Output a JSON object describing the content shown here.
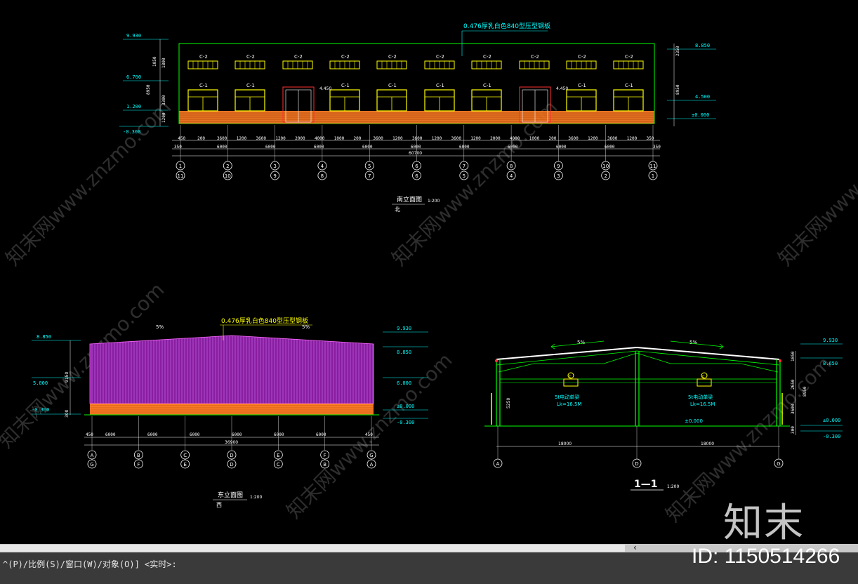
{
  "colors": {
    "bg": "#000000",
    "green": "#00ff00",
    "yellow": "#ffff00",
    "cyan": "#00ffff",
    "white": "#ffffff",
    "red": "#ff3030",
    "magenta": "#c000c0",
    "brick": "#ff7f27",
    "command_bg": "#3a3a3a"
  },
  "south_elevation": {
    "roof_note": "0.476厚乳白色840型压型钢板",
    "window_upper_label": "C-2",
    "window_lower_label": "C-1",
    "title": "南立面图",
    "scale": "1:200",
    "subtitle": "北",
    "levels_left": [
      "9.930",
      "6.700",
      "1.200",
      "-0.300"
    ],
    "levels_right": [
      "8.850",
      "4.500",
      "±0.000"
    ],
    "heights_left": [
      "1050",
      "1800",
      "8950",
      "3300",
      "1200",
      "300"
    ],
    "heights_right": [
      "2350",
      "8950",
      "300"
    ],
    "door_level": "4.450",
    "dim_row1": [
      "450",
      "200",
      "3600",
      "1200",
      "3600",
      "1200",
      "2000",
      "4000",
      "1000",
      "200",
      "3600",
      "1200",
      "3600",
      "1200",
      "3600",
      "1200",
      "2000",
      "4000",
      "1000",
      "200",
      "3600",
      "1200",
      "3600",
      "1200",
      "350"
    ],
    "dim_row2": [
      "350",
      "6000",
      "6000",
      "6000",
      "6000",
      "6000",
      "6000",
      "6000",
      "6000",
      "6000",
      "350"
    ],
    "total": "60700",
    "axes_top": [
      "1",
      "2",
      "3",
      "4",
      "5",
      "6",
      "7",
      "8",
      "9",
      "10",
      "11"
    ],
    "axes_bottom": [
      "11",
      "10",
      "9",
      "8",
      "7",
      "6",
      "5",
      "4",
      "3",
      "2",
      "1"
    ]
  },
  "east_elevation": {
    "roof_note": "0.476厚乳白色840型压型钢板",
    "slope": "5%",
    "title": "东立面图",
    "scale": "1:200",
    "subtitle": "西",
    "levels_left": [
      "8.850",
      "5.000",
      "-0.300"
    ],
    "levels_right": [
      "9.930",
      "8.850",
      "6.000",
      "±0.000",
      "-0.300"
    ],
    "height_left": "9150",
    "height_left2": "300",
    "dims": [
      "450",
      "6000",
      "6000",
      "6000",
      "6000",
      "6000",
      "6000",
      "450"
    ],
    "total": "36900",
    "axes_top": [
      "A",
      "B",
      "C",
      "D",
      "E",
      "F",
      "G"
    ],
    "axes_bottom": [
      "G",
      "F",
      "E",
      "D",
      "C",
      "B",
      "A"
    ]
  },
  "section": {
    "slope": "5%",
    "crane_label": "5t电动单梁",
    "crane_span": "Lk=16.5M",
    "crane_mark": "C",
    "level_ground": "±0.000",
    "height_mid": "5250",
    "levels_right": [
      "9.930",
      "8.650",
      "±0.000",
      "-0.300"
    ],
    "heights_right": [
      "1050",
      "2650",
      "3600",
      "300"
    ],
    "height_right2": "8950",
    "dims": [
      "18000",
      "18000"
    ],
    "axes": [
      "A",
      "D",
      "G"
    ],
    "title": "1—1",
    "scale": "1:200"
  },
  "command": {
    "text": "^(P)/比例(S)/窗口(W)/对象(O)] <实时>:"
  },
  "watermark": {
    "brand": "知末",
    "id": "ID: 1150514266",
    "diag1": "知末网www.znzmo.com",
    "diag2": "知末网www.znzmo.com"
  }
}
